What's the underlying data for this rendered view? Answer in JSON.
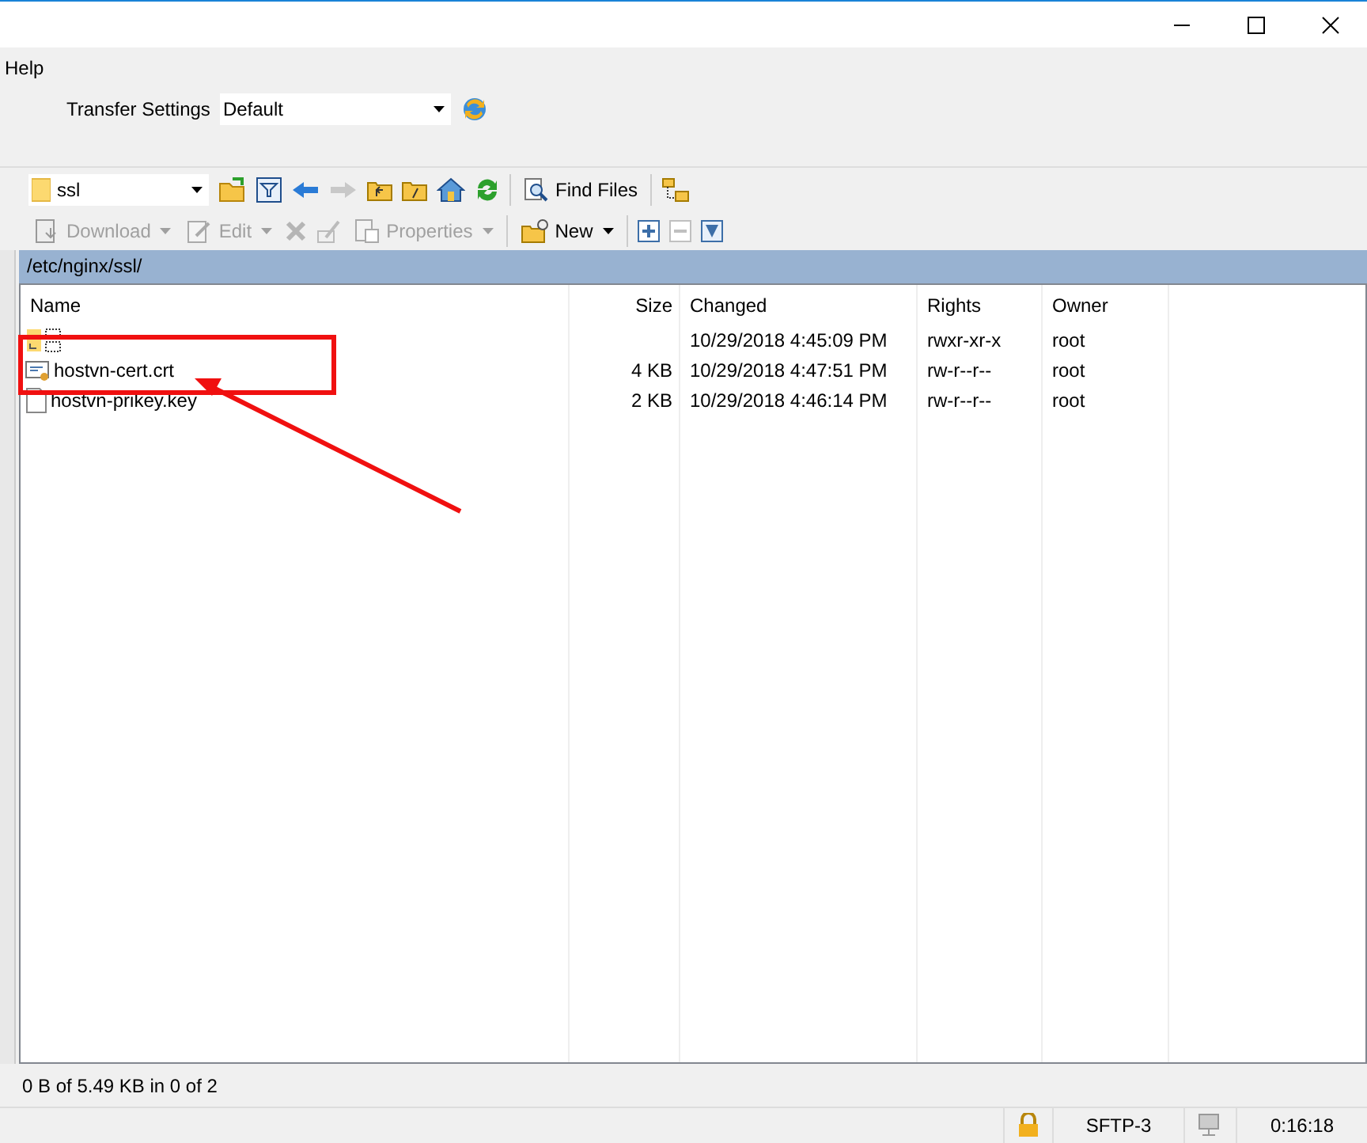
{
  "menu": [
    {
      "label": "Help"
    }
  ],
  "transfer_settings": {
    "label": "Transfer Settings",
    "value": "Default"
  },
  "location": {
    "value": "ssl"
  },
  "find_files": {
    "label": "Find Files"
  },
  "actions": [
    {
      "kind": "download",
      "label": "Download",
      "disabled": true
    },
    {
      "kind": "edit",
      "label": "Edit",
      "disabled": true
    },
    {
      "kind": "properties",
      "label": "Properties",
      "disabled": true
    },
    {
      "kind": "new",
      "label": "New",
      "disabled": false
    }
  ],
  "path": "/etc/nginx/ssl/",
  "table": {
    "columns": [
      "Name",
      "Size",
      "Changed",
      "Rights",
      "Owner"
    ],
    "rows": [
      {
        "kind": "parent",
        "changed": "10/29/2018 4:45:09 PM",
        "rights": "rwxr-xr-x",
        "owner": "root"
      },
      {
        "kind": "certificate",
        "name": "hostvn-cert.crt",
        "size": "4 KB",
        "changed": "10/29/2018 4:47:51 PM",
        "rights": "rw-r--r--",
        "owner": "root"
      },
      {
        "kind": "file",
        "name": "hostvn-prikey.key",
        "size": "2 KB",
        "changed": "10/29/2018 4:46:14 PM",
        "rights": "rw-r--r--",
        "owner": "root"
      }
    ]
  },
  "status": "0 B of 5.49 KB in 0 of 2",
  "status_bar": {
    "protocol": "SFTP-3",
    "time": "0:16:18"
  }
}
